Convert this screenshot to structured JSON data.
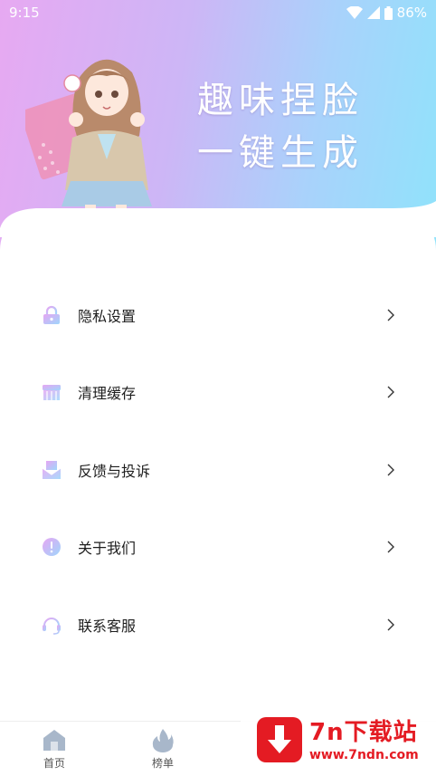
{
  "status_bar": {
    "time": "9:15",
    "battery": "86%"
  },
  "banner": {
    "line1": "趣味捏脸",
    "line2": "一键生成"
  },
  "menu": {
    "items": [
      {
        "label": "隐私设置",
        "icon": "lock-icon"
      },
      {
        "label": "清理缓存",
        "icon": "broom-icon"
      },
      {
        "label": "反馈与投诉",
        "icon": "mail-icon"
      },
      {
        "label": "关于我们",
        "icon": "info-icon"
      },
      {
        "label": "联系客服",
        "icon": "headset-icon"
      }
    ]
  },
  "tabbar": {
    "tabs": [
      {
        "label": "首页",
        "icon": "home-icon"
      },
      {
        "label": "榜单",
        "icon": "flame-icon"
      }
    ]
  },
  "watermark": {
    "brand": "7n下载站",
    "url": "www.7ndn.com"
  },
  "colors": {
    "accent_pink": "#e7a9f2",
    "accent_cyan": "#8fe3fb",
    "watermark_red": "#e41b23"
  }
}
